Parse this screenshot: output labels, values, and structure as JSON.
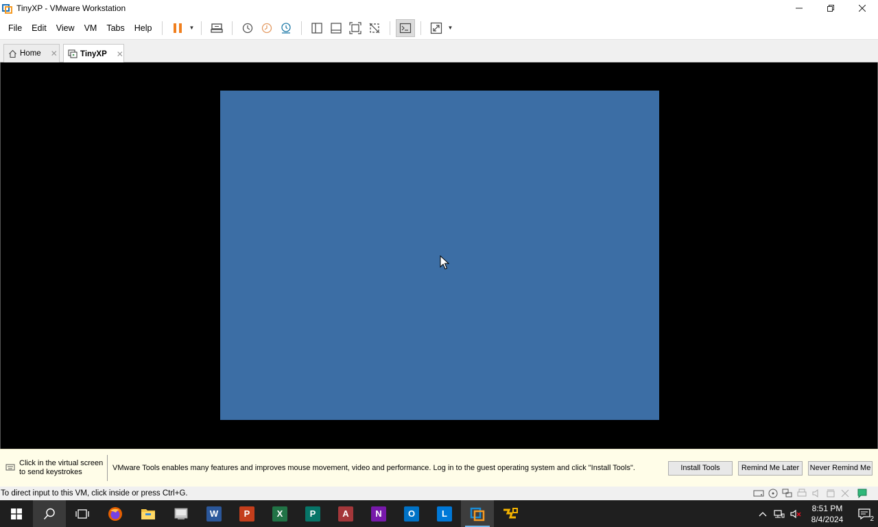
{
  "window": {
    "title": "TinyXP - VMware Workstation",
    "controls": {
      "minimize": "—",
      "restore": "❐",
      "close": "✕"
    }
  },
  "menu": [
    "File",
    "Edit",
    "View",
    "VM",
    "Tabs",
    "Help"
  ],
  "toolbar": {
    "icons": [
      "pause-icon",
      "send-ctrl-alt-del-icon",
      "snapshot-icon",
      "revert-snapshot-icon",
      "snapshot-manager-icon",
      "show-library-icon",
      "thumbnail-bar-icon",
      "full-screen-icon",
      "unity-icon",
      "console-view-icon",
      "stretch-guest-icon"
    ]
  },
  "tabs": [
    {
      "label": "Home",
      "close": "✕",
      "active": false
    },
    {
      "label": "TinyXP",
      "close": "✕",
      "active": true
    }
  ],
  "vm": {
    "guest_color": "#3c6ea5"
  },
  "notification": {
    "hint": "Click in the virtual screen to send keystrokes",
    "message": "VMware Tools enables many features and improves mouse movement, video and performance. Log in to the guest operating system and click \"Install Tools\".",
    "buttons": {
      "install": "Install Tools",
      "remind_later": "Remind Me Later",
      "never_remind": "Never Remind Me"
    }
  },
  "statusbar": {
    "text": "To direct input to this VM, click inside or press Ctrl+G."
  },
  "taskbar": {
    "apps": [
      {
        "name": "firefox",
        "label": ""
      },
      {
        "name": "file-explorer",
        "label": ""
      },
      {
        "name": "generic-app",
        "label": ""
      },
      {
        "name": "word",
        "label": "W",
        "color": "#2b579a"
      },
      {
        "name": "powerpoint",
        "label": "P",
        "color": "#c43e1c"
      },
      {
        "name": "excel",
        "label": "X",
        "color": "#217346"
      },
      {
        "name": "publisher",
        "label": "P",
        "color": "#077568"
      },
      {
        "name": "access",
        "label": "A",
        "color": "#a4373a"
      },
      {
        "name": "onenote",
        "label": "N",
        "color": "#7719aa"
      },
      {
        "name": "outlook",
        "label": "O",
        "color": "#0072c6"
      },
      {
        "name": "lync",
        "label": "L",
        "color": "#0078d7"
      },
      {
        "name": "vmware",
        "label": ""
      },
      {
        "name": "vmware-player",
        "label": ""
      }
    ],
    "clock": {
      "time": "8:51 PM",
      "date": "8/4/2024"
    },
    "notification_count": "2"
  }
}
